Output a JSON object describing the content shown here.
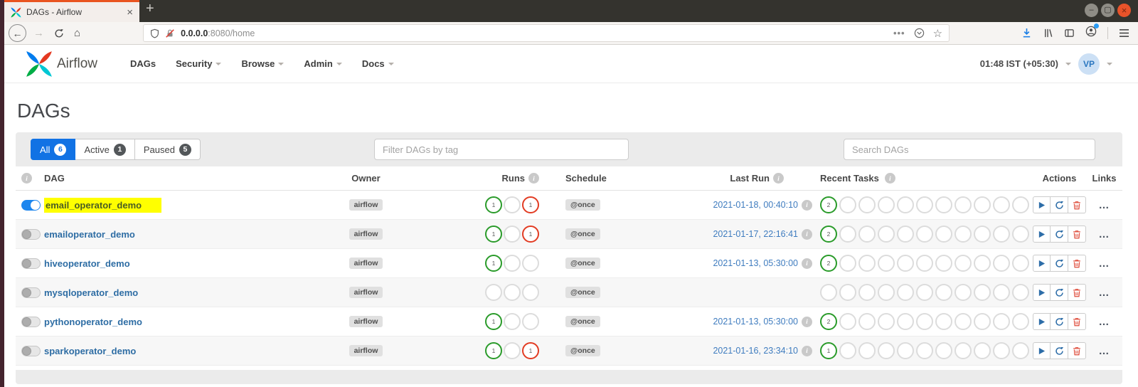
{
  "browser": {
    "tab_title": "DAGs - Airflow",
    "new_tab_label": "+",
    "url": {
      "host": "0.0.0.0",
      "path": ":8080/home"
    }
  },
  "header": {
    "brand": "Airflow",
    "nav": [
      {
        "label": "DAGs"
      },
      {
        "label": "Security"
      },
      {
        "label": "Browse"
      },
      {
        "label": "Admin"
      },
      {
        "label": "Docs"
      }
    ],
    "clock": "01:48 IST (+05:30)",
    "avatar_initials": "VP"
  },
  "page": {
    "title": "DAGs",
    "filter_tabs": [
      {
        "label": "All",
        "count": "6",
        "active": true
      },
      {
        "label": "Active",
        "count": "1",
        "active": false
      },
      {
        "label": "Paused",
        "count": "5",
        "active": false
      }
    ],
    "tag_filter_placeholder": "Filter DAGs by tag",
    "search_placeholder": "Search DAGs"
  },
  "table": {
    "headers": {
      "dag": "DAG",
      "owner": "Owner",
      "runs": "Runs",
      "schedule": "Schedule",
      "last_run": "Last Run",
      "recent_tasks": "Recent Tasks",
      "actions": "Actions",
      "links": "Links"
    },
    "recent_task_slots": 11,
    "links_label": "…",
    "rows": [
      {
        "name": "email_operator_demo",
        "enabled": true,
        "highlight": true,
        "owner": "airflow",
        "runs": [
          {
            "state": "success",
            "count": "1"
          },
          {
            "state": "none",
            "count": ""
          },
          {
            "state": "failed",
            "count": "1"
          }
        ],
        "schedule": "@once",
        "last_run": "2021-01-18, 00:40:10",
        "recent_tasks": [
          {
            "state": "success",
            "count": "2"
          }
        ]
      },
      {
        "name": "emailoperator_demo",
        "enabled": false,
        "highlight": false,
        "owner": "airflow",
        "runs": [
          {
            "state": "success",
            "count": "1"
          },
          {
            "state": "none",
            "count": ""
          },
          {
            "state": "failed",
            "count": "1"
          }
        ],
        "schedule": "@once",
        "last_run": "2021-01-17, 22:16:41",
        "recent_tasks": [
          {
            "state": "success",
            "count": "2"
          }
        ]
      },
      {
        "name": "hiveoperator_demo",
        "enabled": false,
        "highlight": false,
        "owner": "airflow",
        "runs": [
          {
            "state": "success",
            "count": "1"
          },
          {
            "state": "none",
            "count": ""
          },
          {
            "state": "none",
            "count": ""
          }
        ],
        "schedule": "@once",
        "last_run": "2021-01-13, 05:30:00",
        "recent_tasks": [
          {
            "state": "success",
            "count": "2"
          }
        ]
      },
      {
        "name": "mysqloperator_demo",
        "enabled": false,
        "highlight": false,
        "owner": "airflow",
        "runs": [
          {
            "state": "none",
            "count": ""
          },
          {
            "state": "none",
            "count": ""
          },
          {
            "state": "none",
            "count": ""
          }
        ],
        "schedule": "@once",
        "last_run": "",
        "recent_tasks": []
      },
      {
        "name": "pythonoperator_demo",
        "enabled": false,
        "highlight": false,
        "owner": "airflow",
        "runs": [
          {
            "state": "success",
            "count": "1"
          },
          {
            "state": "none",
            "count": ""
          },
          {
            "state": "none",
            "count": ""
          }
        ],
        "schedule": "@once",
        "last_run": "2021-01-13, 05:30:00",
        "recent_tasks": [
          {
            "state": "success",
            "count": "2"
          }
        ]
      },
      {
        "name": "sparkoperator_demo",
        "enabled": false,
        "highlight": false,
        "owner": "airflow",
        "runs": [
          {
            "state": "success",
            "count": "1"
          },
          {
            "state": "none",
            "count": ""
          },
          {
            "state": "failed",
            "count": "1"
          }
        ],
        "schedule": "@once",
        "last_run": "2021-01-16, 23:34:10",
        "recent_tasks": [
          {
            "state": "success",
            "count": "1"
          }
        ]
      }
    ]
  },
  "colors": {
    "accent_blue": "#1172e4",
    "toggle_on_blue": "#1d86ee",
    "success_green": "#2a9b2a",
    "failed_red": "#e23b22",
    "link_blue": "#2e6da4",
    "date_link_blue": "#3f7cbf",
    "highlight_yellow": "#ffff00",
    "highlight_text": "#4a5d23",
    "ubuntu_orange": "#e95420"
  }
}
